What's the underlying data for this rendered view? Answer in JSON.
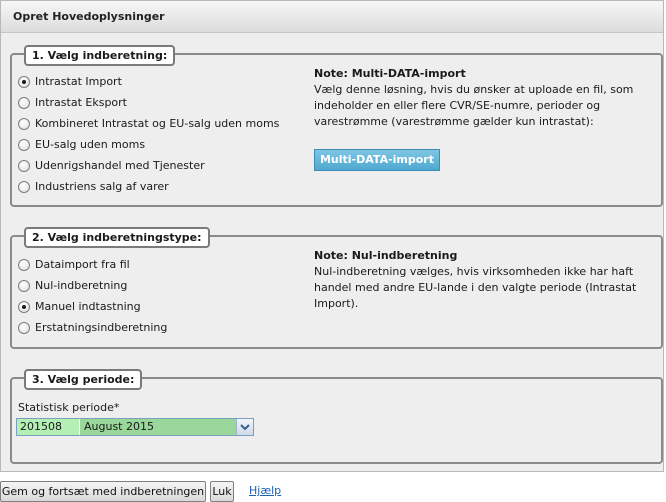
{
  "page_title": "Opret Hovedoplysninger",
  "section1": {
    "legend": "1. Vælg indberetning:",
    "options": [
      {
        "label": "Intrastat Import",
        "checked": true
      },
      {
        "label": "Intrastat Eksport",
        "checked": false
      },
      {
        "label": "Kombineret Intrastat og EU-salg uden moms",
        "checked": false
      },
      {
        "label": "EU-salg uden moms",
        "checked": false
      },
      {
        "label": "Udenrigshandel med Tjenester",
        "checked": false
      },
      {
        "label": "Industriens salg af varer",
        "checked": false
      }
    ],
    "note_title": "Note: Multi-DATA-import",
    "note_lines": [
      "Vælg denne løsning, hvis du ønsker at uploade en fil, som",
      "indeholder en eller flere CVR/SE-numre, perioder og",
      "varestrømme (varestrømme gælder kun intrastat):"
    ],
    "button_label": "Multi-DATA-import",
    "button_color": "#5cb3d9"
  },
  "section2": {
    "legend": "2. Vælg indberetningstype:",
    "options": [
      {
        "label": "Dataimport fra fil",
        "checked": false
      },
      {
        "label": "Nul-indberetning",
        "checked": false
      },
      {
        "label": "Manuel indtastning",
        "checked": true
      },
      {
        "label": "Erstatningsindberetning",
        "checked": false
      }
    ],
    "note_title": "Note: Nul-indberetning",
    "note_lines": [
      "Nul-indberetning vælges, hvis virksomheden ikke har haft",
      "handel med andre EU-lande i den valgte periode (Intrastat",
      "Import)."
    ]
  },
  "section3": {
    "legend": "3. Vælg periode:",
    "field_label": "Statistisk periode*",
    "selected_code": "201508",
    "selected_name": "August 2015",
    "highlight_color": "#9ad79a"
  },
  "footer": {
    "save_label": "Gem og fortsæt med indberetningen",
    "close_label": "Luk",
    "help_label": "Hjælp"
  }
}
